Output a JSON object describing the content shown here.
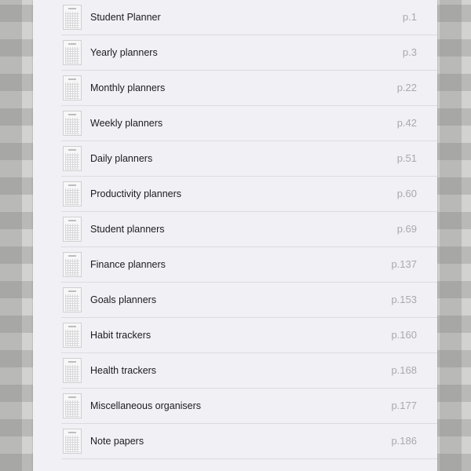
{
  "toc": {
    "items": [
      {
        "title": "Student Planner",
        "page": "p.1",
        "thumb_icon": "planner-page-thumbnail-icon"
      },
      {
        "title": "Yearly planners",
        "page": "p.3",
        "thumb_icon": "planner-page-thumbnail-icon"
      },
      {
        "title": "Monthly planners",
        "page": "p.22",
        "thumb_icon": "planner-page-thumbnail-icon"
      },
      {
        "title": "Weekly planners",
        "page": "p.42",
        "thumb_icon": "planner-page-thumbnail-icon"
      },
      {
        "title": "Daily planners",
        "page": "p.51",
        "thumb_icon": "planner-page-thumbnail-icon"
      },
      {
        "title": "Productivity planners",
        "page": "p.60",
        "thumb_icon": "planner-page-thumbnail-icon"
      },
      {
        "title": "Student planners",
        "page": "p.69",
        "thumb_icon": "planner-page-thumbnail-icon"
      },
      {
        "title": "Finance planners",
        "page": "p.137",
        "thumb_icon": "planner-page-thumbnail-icon"
      },
      {
        "title": "Goals planners",
        "page": "p.153",
        "thumb_icon": "planner-page-thumbnail-icon"
      },
      {
        "title": "Habit trackers",
        "page": "p.160",
        "thumb_icon": "planner-page-thumbnail-icon"
      },
      {
        "title": "Health trackers",
        "page": "p.168",
        "thumb_icon": "planner-page-thumbnail-icon"
      },
      {
        "title": "Miscellaneous organisers",
        "page": "p.177",
        "thumb_icon": "planner-page-thumbnail-icon"
      },
      {
        "title": "Note papers",
        "page": "p.186",
        "thumb_icon": "planner-page-thumbnail-icon"
      }
    ]
  },
  "colors": {
    "panel_background": "#f1f0f5",
    "title_text": "#1c1c1e",
    "page_text": "#a9a9ad",
    "divider": "#dcdbe0",
    "gingham_background": "#d2d2d0"
  }
}
